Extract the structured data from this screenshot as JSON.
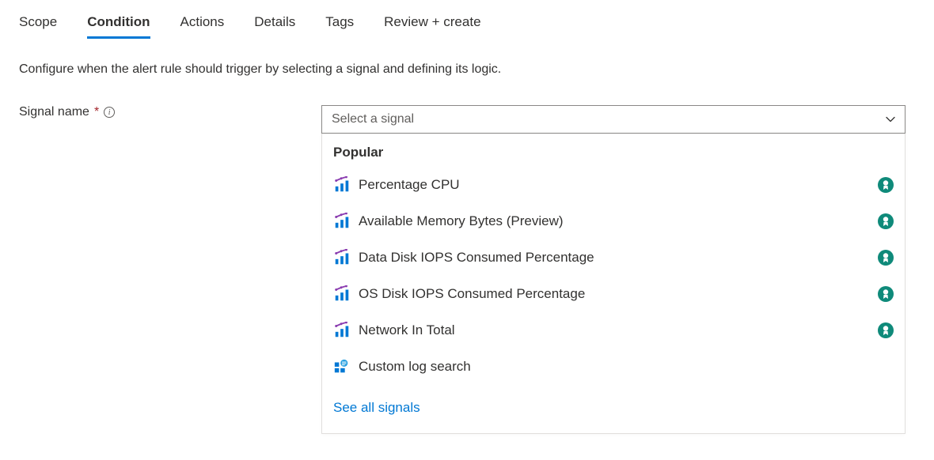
{
  "tabs": [
    {
      "label": "Scope",
      "active": false
    },
    {
      "label": "Condition",
      "active": true
    },
    {
      "label": "Actions",
      "active": false
    },
    {
      "label": "Details",
      "active": false
    },
    {
      "label": "Tags",
      "active": false
    },
    {
      "label": "Review + create",
      "active": false
    }
  ],
  "description": "Configure when the alert rule should trigger by selecting a signal and defining its logic.",
  "field": {
    "label": "Signal name",
    "required_marker": "*"
  },
  "dropdown": {
    "placeholder": "Select a signal",
    "section_title": "Popular",
    "signals": [
      {
        "label": "Percentage CPU",
        "icon": "metric",
        "badge": true
      },
      {
        "label": "Available Memory Bytes (Preview)",
        "icon": "metric",
        "badge": true
      },
      {
        "label": "Data Disk IOPS Consumed Percentage",
        "icon": "metric",
        "badge": true
      },
      {
        "label": "OS Disk IOPS Consumed Percentage",
        "icon": "metric",
        "badge": true
      },
      {
        "label": "Network In Total",
        "icon": "metric",
        "badge": true
      },
      {
        "label": "Custom log search",
        "icon": "log",
        "badge": false
      }
    ],
    "see_all_label": "See all signals"
  }
}
